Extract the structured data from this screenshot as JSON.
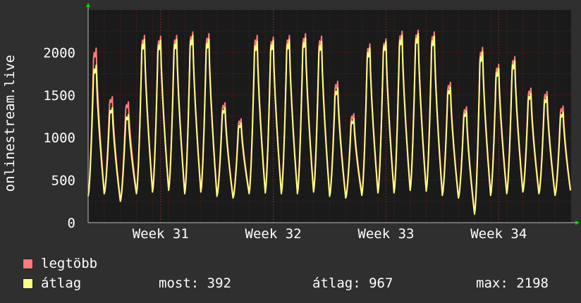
{
  "chart_data": {
    "type": "line",
    "ylabel": "onlinestream.live",
    "ylim": [
      0,
      2500
    ],
    "yticks": [
      0,
      500,
      1000,
      1500,
      2000
    ],
    "xticks": [
      "Week 31",
      "Week 32",
      "Week 33",
      "Week 34"
    ],
    "grid": true,
    "colors": {
      "background": "#2f2f2f",
      "plot": "#1a1a1a",
      "grid": "#5a2020",
      "axis": "#bbbbbb",
      "arrow": "#00dd00"
    },
    "series": [
      {
        "name": "legtöbb",
        "color": "#ff7a7a",
        "daily_peaks": [
          2050,
          1480,
          1420,
          2200,
          2190,
          2200,
          2240,
          2220,
          1410,
          1220,
          2200,
          2180,
          2200,
          2220,
          2190,
          1660,
          1280,
          2100,
          2160,
          2250,
          2260,
          2240,
          1650,
          1360,
          2060,
          1860,
          1950,
          1580,
          1540,
          1370
        ],
        "daily_troughs": [
          320,
          350,
          260,
          360,
          380,
          400,
          360,
          380,
          330,
          300,
          360,
          370,
          360,
          360,
          380,
          330,
          300,
          340,
          370,
          370,
          400,
          390,
          340,
          300,
          120,
          340,
          360,
          380,
          360,
          330
        ]
      },
      {
        "name": "átlag",
        "color": "#ffff80",
        "daily_peaks": [
          1850,
          1350,
          1270,
          2150,
          2140,
          2150,
          2200,
          2160,
          1350,
          1170,
          2130,
          2140,
          2150,
          2170,
          2130,
          1580,
          1220,
          2050,
          2130,
          2200,
          2220,
          2190,
          1590,
          1310,
          2010,
          1810,
          1900,
          1520,
          1480,
          1300
        ],
        "daily_troughs": [
          310,
          340,
          250,
          340,
          360,
          380,
          340,
          360,
          310,
          290,
          340,
          350,
          340,
          340,
          360,
          310,
          290,
          320,
          350,
          350,
          380,
          370,
          320,
          290,
          100,
          320,
          340,
          360,
          340,
          320
        ]
      }
    ]
  },
  "legend": {
    "items": [
      {
        "label": "legtöbb",
        "color": "#ff7a7a"
      },
      {
        "label": "átlag",
        "color": "#ffff80"
      }
    ],
    "stats": {
      "most": "most: 392",
      "atlag": "átlag: 967",
      "max": "max: 2198"
    }
  }
}
